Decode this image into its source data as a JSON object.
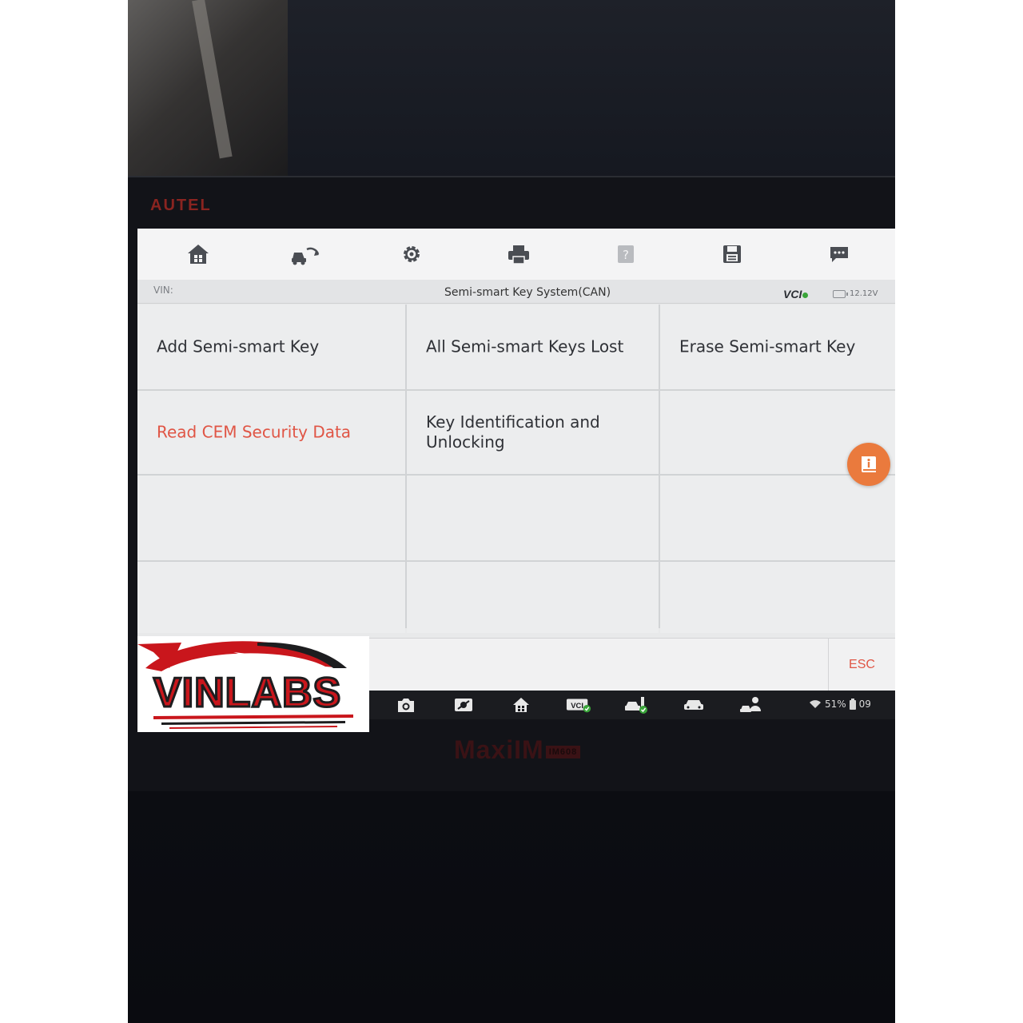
{
  "device": {
    "brand": "AUTEL",
    "model": "MaxiIM",
    "model_sub": "IM608"
  },
  "toolbar": {
    "items": [
      {
        "name": "home",
        "icon": "home-icon"
      },
      {
        "name": "vehicle-swap",
        "icon": "vehicle-swap-icon"
      },
      {
        "name": "settings",
        "icon": "gear-icon"
      },
      {
        "name": "print",
        "icon": "printer-icon"
      },
      {
        "name": "help",
        "icon": "help-icon"
      },
      {
        "name": "save",
        "icon": "save-icon"
      },
      {
        "name": "feedback",
        "icon": "chat-icon"
      }
    ]
  },
  "infobar": {
    "vin_label": "VIN:",
    "title": "Semi-smart Key System(CAN)",
    "vci_label": "VCI",
    "voltage": "12.12V"
  },
  "grid": {
    "items": [
      {
        "label": "Add Semi-smart Key",
        "highlight": false
      },
      {
        "label": "All Semi-smart Keys Lost",
        "highlight": false
      },
      {
        "label": "Erase Semi-smart Key",
        "highlight": false
      },
      {
        "label": "Read CEM Security Data",
        "highlight": true
      },
      {
        "label": "Key Identification and Unlocking",
        "highlight": false
      }
    ]
  },
  "footer": {
    "esc_label": "ESC"
  },
  "taskbar": {
    "icons": [
      "camera-icon",
      "display-brightness-icon",
      "home-icon",
      "vci-icon",
      "vehicle-connect-icon",
      "car-icon",
      "remote-expert-icon"
    ],
    "battery": "51%",
    "time": "09"
  },
  "overlay_logo": {
    "text": "VINLABS"
  },
  "colors": {
    "accent_red": "#e05545",
    "help_orange": "#ea7a3d",
    "screen_bg": "#ecedee"
  }
}
